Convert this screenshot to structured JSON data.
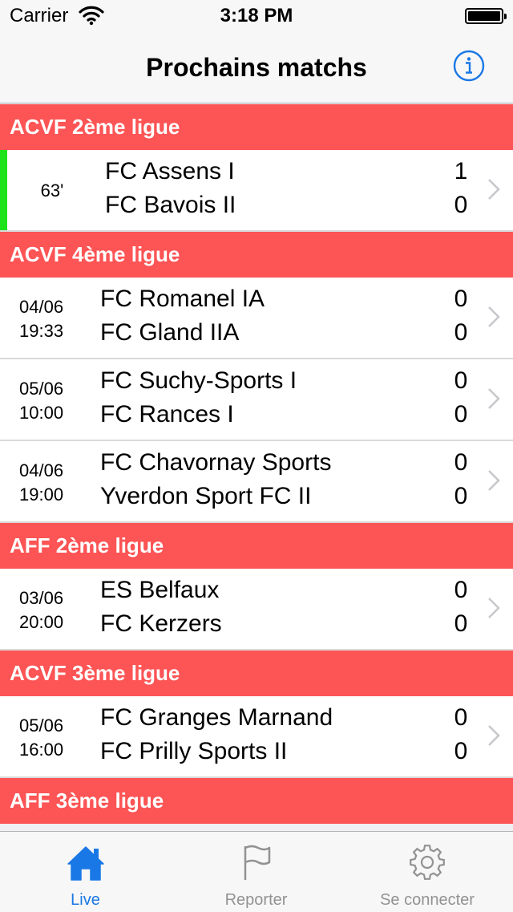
{
  "status": {
    "carrier": "Carrier",
    "time": "3:18 PM"
  },
  "nav": {
    "title": "Prochains matchs",
    "info_icon": "info-circle-icon"
  },
  "colors": {
    "section_bg": "#fd5455",
    "live_green": "#1ee31a",
    "tint": "#1a78e6",
    "tab_inactive": "#929292"
  },
  "sections": [
    {
      "title": "ACVF 2ème ligue",
      "matches": [
        {
          "minute": "63'",
          "home": "FC Assens I",
          "away": "FC Bavois II",
          "home_score": "1",
          "away_score": "0",
          "live": true
        }
      ]
    },
    {
      "title": "ACVF 4ème ligue",
      "matches": [
        {
          "date": "04/06",
          "time": "19:33",
          "home": "FC Romanel IA",
          "away": "FC Gland IIA",
          "home_score": "0",
          "away_score": "0"
        },
        {
          "date": "05/06",
          "time": "10:00",
          "home": "FC Suchy-Sports I",
          "away": "FC Rances I",
          "home_score": "0",
          "away_score": "0"
        },
        {
          "date": "04/06",
          "time": "19:00",
          "home": "FC Chavornay Sports",
          "away": "Yverdon Sport FC II",
          "home_score": "0",
          "away_score": "0"
        }
      ]
    },
    {
      "title": "AFF 2ème ligue",
      "matches": [
        {
          "date": "03/06",
          "time": "20:00",
          "home": "ES Belfaux",
          "away": "FC Kerzers",
          "home_score": "0",
          "away_score": "0"
        }
      ]
    },
    {
      "title": "ACVF 3ème ligue",
      "matches": [
        {
          "date": "05/06",
          "time": "16:00",
          "home": "FC Granges Marnand",
          "away": "FC Prilly Sports II",
          "home_score": "0",
          "away_score": "0"
        }
      ]
    },
    {
      "title": "AFF 3ème ligue",
      "matches": []
    }
  ],
  "tabs": [
    {
      "label": "Live",
      "icon": "home-icon",
      "active": true
    },
    {
      "label": "Reporter",
      "icon": "flag-icon",
      "active": false
    },
    {
      "label": "Se connecter",
      "icon": "gear-icon",
      "active": false
    }
  ]
}
